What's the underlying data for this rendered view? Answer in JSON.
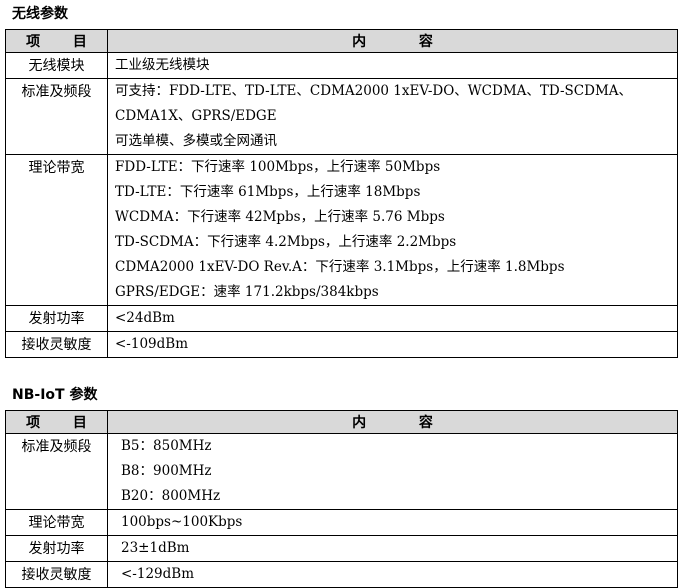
{
  "wireless": {
    "title": "无线参数",
    "header": {
      "col1": "项 目",
      "col2": "内 容"
    },
    "rows": [
      {
        "label": "无线模块",
        "lines": [
          "工业级无线模块"
        ]
      },
      {
        "label": "标准及频段",
        "lines": [
          "可支持：FDD-LTE、TD-LTE、CDMA2000 1xEV-DO、WCDMA、TD-SCDMA、",
          "CDMA1X、GPRS/EDGE",
          "可选单模、多模或全网通讯"
        ]
      },
      {
        "label": "理论带宽",
        "lines": [
          "FDD-LTE：下行速率 100Mbps，上行速率 50Mbps",
          "TD-LTE：下行速率 61Mbps，上行速率 18Mbps",
          "WCDMA：下行速率 42Mpbs，上行速率 5.76 Mbps",
          "TD-SCDMA：下行速率 4.2Mbps，上行速率 2.2Mbps",
          "CDMA2000 1xEV-DO Rev.A：下行速率 3.1Mbps，上行速率 1.8Mbps",
          "GPRS/EDGE：速率 171.2kbps/384kbps"
        ]
      },
      {
        "label": "发射功率",
        "lines": [
          "<24dBm"
        ]
      },
      {
        "label": "接收灵敏度",
        "lines": [
          "<-109dBm"
        ]
      }
    ]
  },
  "nbiot": {
    "title": "NB-IoT 参数",
    "header": {
      "col1": "项 目",
      "col2": "内 容"
    },
    "rows": [
      {
        "label": "标准及频段",
        "lines": [
          "B5：850MHz",
          "B8：900MHz",
          "B20：800MHz"
        ]
      },
      {
        "label": "理论带宽",
        "lines": [
          "100bps~100Kbps"
        ]
      },
      {
        "label": "发射功率",
        "lines": [
          "23±1dBm"
        ]
      },
      {
        "label": "接收灵敏度",
        "lines": [
          "<-129dBm"
        ]
      }
    ]
  }
}
